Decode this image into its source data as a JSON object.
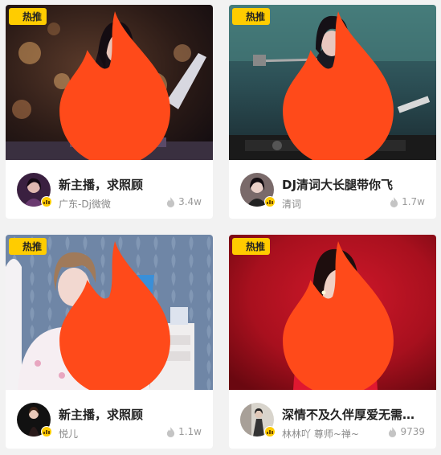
{
  "badge_label": "热推",
  "cards": [
    {
      "title": "新主播，求照顾",
      "anchor": "广东-Dj微微",
      "popularity": "3.4w"
    },
    {
      "title": "DJ清词大长腿带你飞",
      "anchor": "清词",
      "popularity": "1.7w"
    },
    {
      "title": "新主播，求照顾",
      "anchor": "悦儿",
      "popularity": "1.1w"
    },
    {
      "title": "深情不及久伴厚爱无需多言",
      "anchor": "林林吖 尊师~禅~",
      "popularity": "9739"
    }
  ],
  "colors": {
    "badge": "#ffcc00",
    "card_bg": "#ffffff",
    "page_bg": "#f2f2f2"
  }
}
